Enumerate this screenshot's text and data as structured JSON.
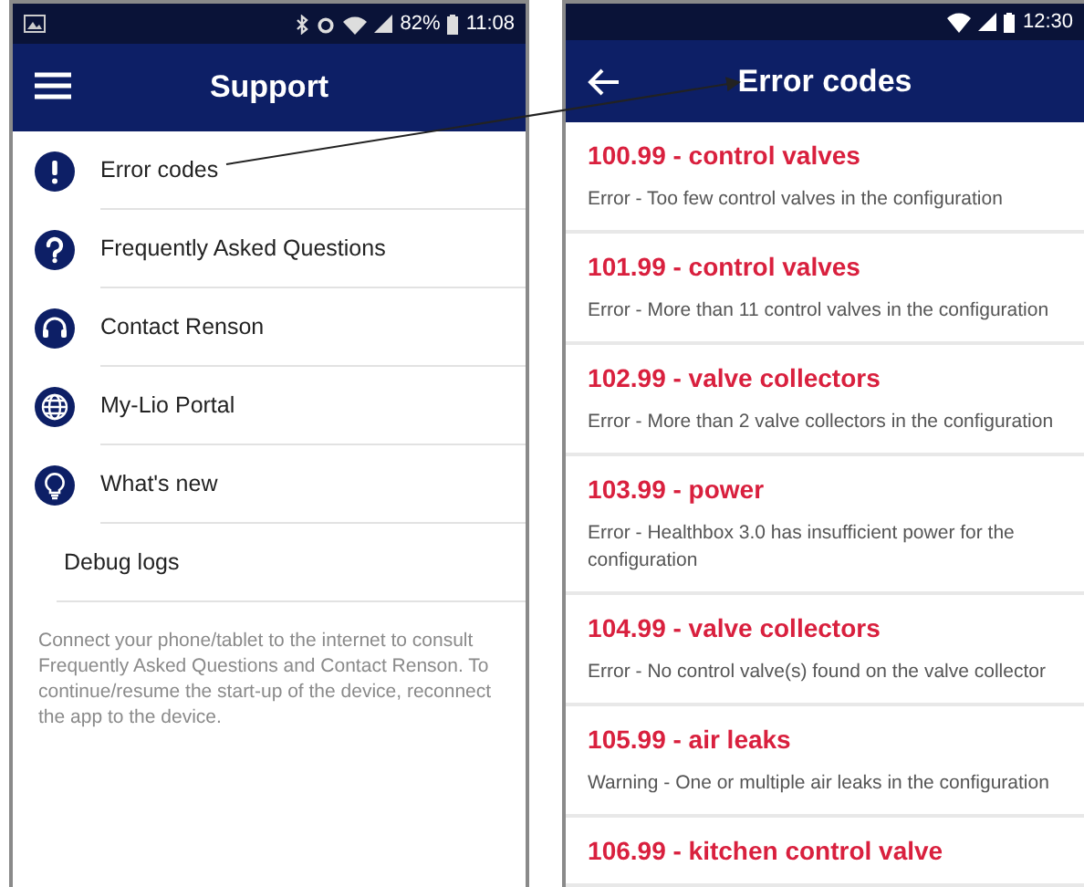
{
  "support_screen": {
    "status_bar": {
      "battery": "82%",
      "time": "11:08"
    },
    "title": "Support",
    "menu_items": [
      {
        "kind": "icon",
        "label": "Error codes"
      },
      {
        "kind": "icon",
        "label": "Frequently Asked Questions"
      },
      {
        "kind": "icon",
        "label": "Contact Renson"
      },
      {
        "kind": "icon",
        "label": "My-Lio Portal"
      },
      {
        "kind": "icon",
        "label": "What's new"
      },
      {
        "kind": "plain",
        "label": "Debug logs"
      }
    ],
    "note": "Connect your phone/tablet to the internet to consult Frequently Asked Questions and Contact Renson. To continue/resume the start-up of the device, reconnect the app to the device."
  },
  "error_codes_screen": {
    "status_bar": {
      "time": "12:30"
    },
    "title": "Error codes",
    "codes": [
      {
        "title": "100.99 - control valves",
        "description": "Error - Too few control valves in the configuration"
      },
      {
        "title": "101.99 - control valves",
        "description": "Error - More than 11 control valves in the configuration"
      },
      {
        "title": "102.99 - valve collectors",
        "description": "Error - More than 2 valve collectors in the configuration"
      },
      {
        "title": "103.99 - power",
        "description": "Error - Healthbox 3.0 has insufficient power for the configuration"
      },
      {
        "title": "104.99 - valve collectors",
        "description": "Error - No control valve(s) found on the valve collector"
      },
      {
        "title": "105.99 - air leaks",
        "description": "Warning - One or multiple air leaks in the configuration"
      },
      {
        "title": "106.99 - kitchen control valve"
      }
    ]
  }
}
